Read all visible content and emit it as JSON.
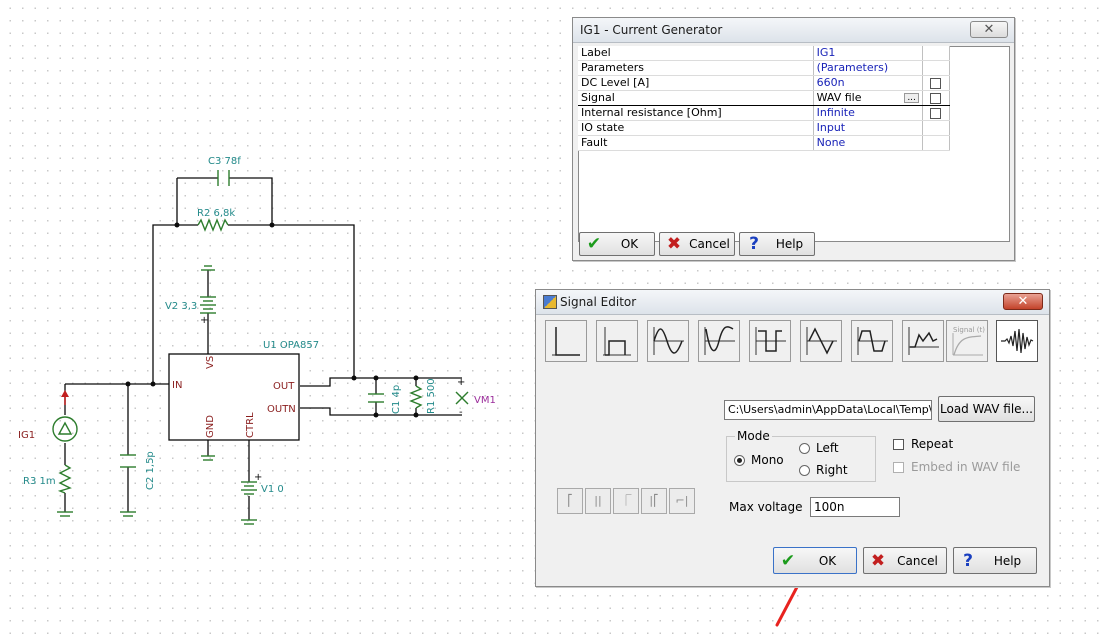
{
  "schematic": {
    "labels": {
      "c3": "C3 78f",
      "r2": "R2 6,8k",
      "v2": "V2 3,3",
      "u1": "U1 OPA857",
      "vs": "VS",
      "in": "IN",
      "out": "OUT",
      "outn": "OUTN",
      "gnd": "GND",
      "ctrl": "CTRL",
      "c1": "C1 4p",
      "r1": "R1 500",
      "vm1": "VM1",
      "ig1": "IG1",
      "r3": "R3 1m",
      "c2": "C2 1,5p",
      "v1": "V1 0",
      "plus": "+",
      "minus": "-"
    }
  },
  "current_generator": {
    "title": "IG1 - Current Generator",
    "properties": [
      {
        "name": "Label",
        "value": "IG1",
        "checkbox": false
      },
      {
        "name": "Parameters",
        "value": "(Parameters)",
        "checkbox": false
      },
      {
        "name": "DC Level [A]",
        "value": "660n",
        "checkbox": true
      },
      {
        "name": "Signal",
        "value": "WAV file",
        "checkbox": true
      },
      {
        "name": "Internal resistance [Ohm]",
        "value": "Infinite",
        "checkbox": true
      },
      {
        "name": "IO state",
        "value": "Input",
        "checkbox": false
      },
      {
        "name": "Fault",
        "value": "None",
        "checkbox": false
      }
    ],
    "more_button": "...",
    "ok_label": "OK",
    "cancel_label": "Cancel",
    "help_label": "Help"
  },
  "signal_editor": {
    "title": "Signal Editor",
    "waveform_buttons": [
      "unit-step",
      "square-pulse",
      "sine",
      "cosine",
      "square",
      "triangle",
      "trapezoid",
      "piecewise-linear",
      "general",
      "wav-file"
    ],
    "general_button_label": "Signal (t)",
    "file_path": "C:\\Users\\admin\\AppData\\Local\\Temp\\inp",
    "load_wav_label": "Load WAV file...",
    "mode_label": "Mode",
    "mono_label": "Mono",
    "left_label": "Left",
    "right_label": "Right",
    "mode_selected": "Mono",
    "repeat_label": "Repeat",
    "repeat_checked": false,
    "embed_label": "Embed in WAV file",
    "embed_checked": false,
    "embed_enabled": false,
    "max_voltage_label": "Max voltage",
    "max_voltage_value": "100n",
    "ok_label": "OK",
    "cancel_label": "Cancel",
    "help_label": "Help"
  },
  "annotation": {
    "arrow_color": "#e8231f"
  },
  "colors": {
    "wire": "#0c0c0c",
    "component": "#2d7d2d",
    "label": "#238a8a",
    "pin": "#8a1e1e",
    "value": "#1a24b8"
  }
}
